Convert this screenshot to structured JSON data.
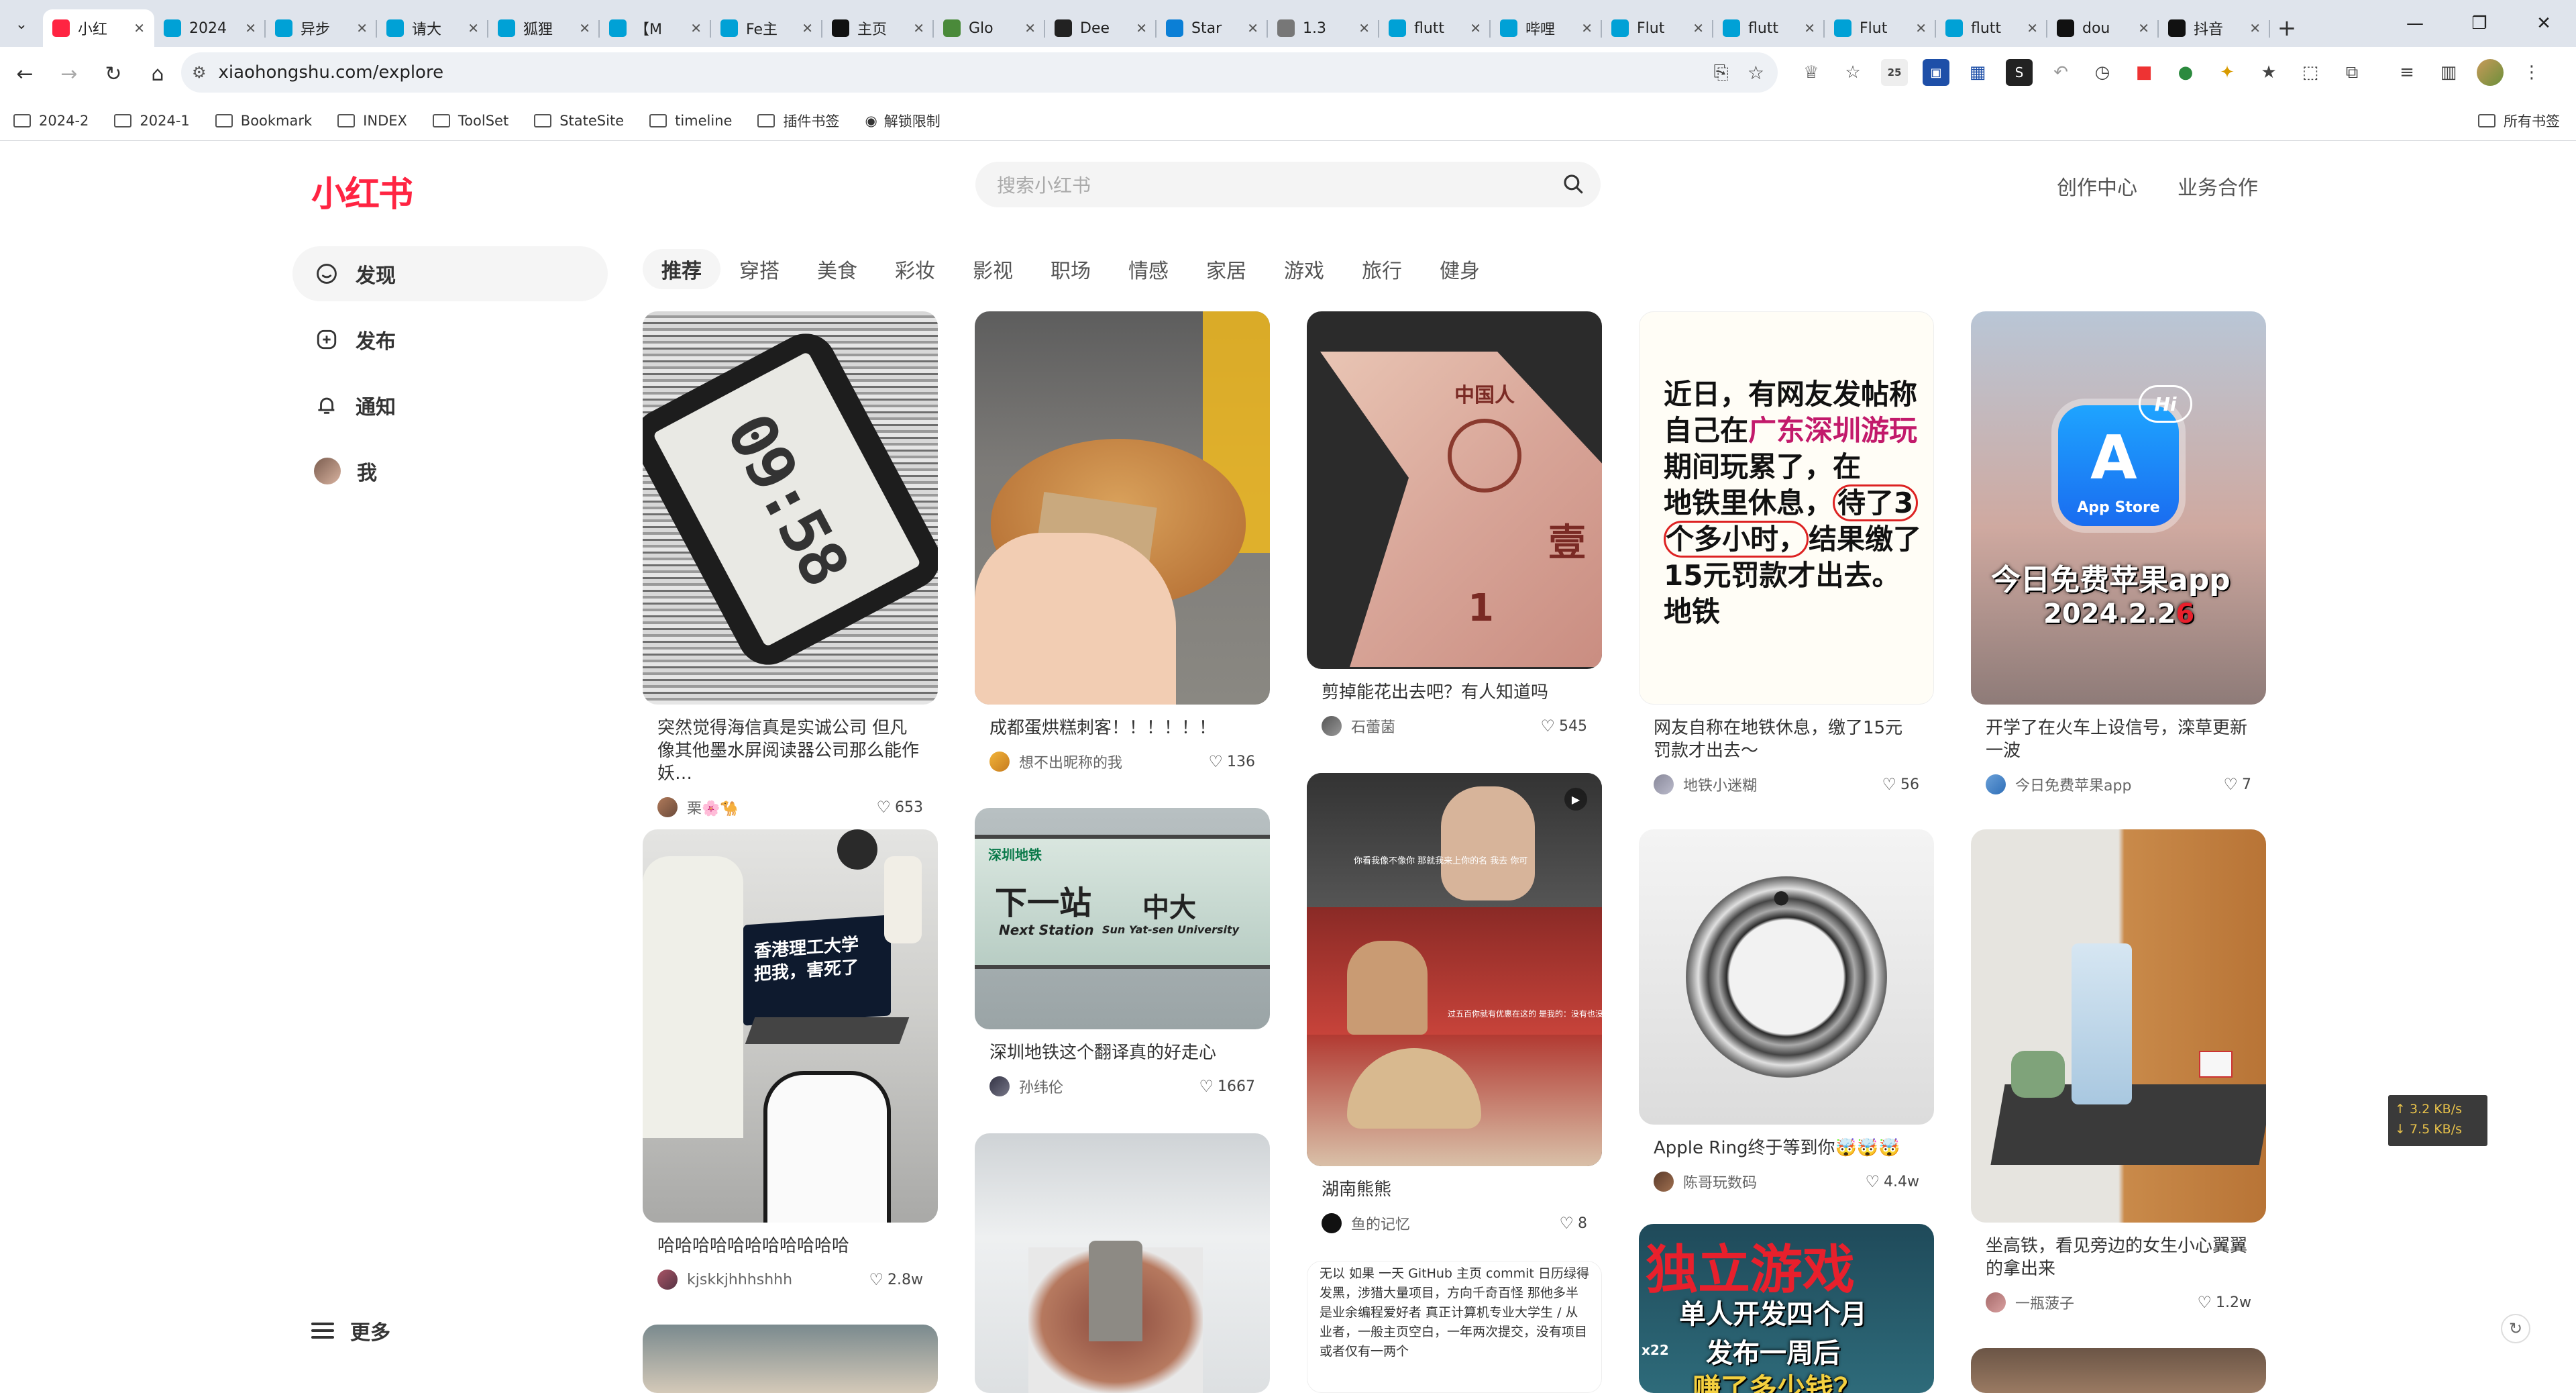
{
  "browser": {
    "tabs": [
      {
        "label": "小红",
        "active": true,
        "color": "#ff2442"
      },
      {
        "label": "2024",
        "color": "#00a1d6"
      },
      {
        "label": "异步",
        "color": "#00a1d6"
      },
      {
        "label": "请大",
        "color": "#00a1d6"
      },
      {
        "label": "狐狸",
        "color": "#00a1d6"
      },
      {
        "label": "【M",
        "color": "#00a1d6"
      },
      {
        "label": "Fe主",
        "color": "#00a1d6"
      },
      {
        "label": "主页",
        "color": "#111111"
      },
      {
        "label": "Glo",
        "color": "#4a8a3a"
      },
      {
        "label": "Dee",
        "color": "#222222"
      },
      {
        "label": "Star",
        "color": "#0b7fd6"
      },
      {
        "label": "1.3",
        "color": "#777777"
      },
      {
        "label": "flutt",
        "color": "#00a1d6"
      },
      {
        "label": "哔哩",
        "color": "#00a1d6"
      },
      {
        "label": "Flut",
        "color": "#00a1d6"
      },
      {
        "label": "flutt",
        "color": "#00a1d6"
      },
      {
        "label": "Flut",
        "color": "#00a1d6"
      },
      {
        "label": "flutt",
        "color": "#00a1d6"
      },
      {
        "label": "dou",
        "color": "#111111"
      },
      {
        "label": "抖音",
        "color": "#111111"
      }
    ],
    "url": "xiaohongshu.com/explore",
    "ext_badge": "25",
    "bookmarks": [
      "2024-2",
      "2024-1",
      "Bookmark",
      "INDEX",
      "ToolSet",
      "StateSite",
      "timeline",
      "插件书签",
      "解锁限制"
    ],
    "all_bookmarks": "所有书签"
  },
  "site": {
    "logo": "小红书",
    "search_placeholder": "搜索小红书",
    "top_links": [
      "创作中心",
      "业务合作"
    ],
    "sidebar": [
      {
        "label": "发现",
        "icon": "home-icon",
        "active": true
      },
      {
        "label": "发布",
        "icon": "plus-icon"
      },
      {
        "label": "通知",
        "icon": "bell-icon"
      },
      {
        "label": "我",
        "icon": "avatar"
      }
    ],
    "more": "更多",
    "channels": [
      "推荐",
      "穿搭",
      "美食",
      "彩妆",
      "影视",
      "职场",
      "情感",
      "家居",
      "游戏",
      "旅行",
      "健身"
    ]
  },
  "feed": {
    "col1": [
      {
        "title": "突然觉得海信真是实诚公司 但凡像其他墨水屏阅读器公司那么能作妖…",
        "author": "栗🌸🐪",
        "likes": "653",
        "clock": "09:58"
      },
      {
        "title": "哈哈哈哈哈哈哈哈哈哈哈",
        "author": "kjskkjhhhshhh",
        "likes": "2.8w",
        "laptop": "香港理工大学 把我，害死了"
      }
    ],
    "col2": [
      {
        "title": "成都蛋烘糕刺客！！！！！！",
        "author": "想不出昵称的我",
        "likes": "136"
      },
      {
        "title": "深圳地铁这个翻译真的好走心",
        "author": "孙纬伦",
        "likes": "1667",
        "sign_a": "下一站",
        "sign_b": "中大",
        "sign_c": "Next Station",
        "sign_d": "Sun Yat-sen University",
        "sign_e": "深圳地铁"
      }
    ],
    "col3": [
      {
        "title": "剪掉能花出去吧？有人知道吗",
        "author": "石蕾菌",
        "likes": "545",
        "money": "中国人",
        "money_b": "壹",
        "money_c": "1"
      },
      {
        "title": "湖南熊熊",
        "author": "鱼的记忆",
        "likes": "8",
        "cap_a": "你看我像不像你 那就我来上你的名 我去 你可",
        "cap_b": "过五百你就有优惠在这的 是我的：没有也没有关系"
      },
      {
        "title": "",
        "author": "",
        "likes": "",
        "text": "无以 如果 一天 GitHub 主页 commit 日历绿得发黑，涉猎大量项目，方向千奇百怪 那他多半是业余编程爱好者 真正计算机专业大学生 / 从业者，一般主页空白，一年两次提交，没有项目或者仅有一两个"
      }
    ],
    "col4": [
      {
        "title": "网友自称在地铁休息，缴了15元罚款才出去～",
        "author": "地铁小迷糊",
        "likes": "56",
        "art_a": "近日，有网友发帖称",
        "art_b": "自己在",
        "art_c": "广东深圳游玩",
        "art_d": "期间玩累了，在",
        "art_e": "地铁里休息，",
        "art_f": "待了3",
        "art_g": "个多小时，",
        "art_h": "结果缴了",
        "art_i": "15元罚款才出去。",
        "art_j": "地铁"
      },
      {
        "title": "Apple Ring终于等到你🤯🤯🤯",
        "author": "陈哥玩数码",
        "likes": "4.4w"
      },
      {
        "title": "",
        "author": "",
        "likes": "",
        "big": "独立游戏",
        "sub1": "单人开发四个月",
        "sub2": "发布一周后",
        "sub3": "赚了多少钱？",
        "tag": "x22"
      }
    ],
    "col5": [
      {
        "title": "开学了在火车上设信号，滦草更新一波",
        "author": "今日免费苹果app",
        "likes": "7",
        "app_store": "App Store",
        "hi": "Hi",
        "big": "今日免费苹果app",
        "date": "2024.2.2",
        "date_red": "6"
      },
      {
        "title": "坐高铁，看见旁边的女生小心翼翼的拿出来",
        "author": "一瓶菠子",
        "likes": "1.2w"
      }
    ]
  },
  "netspeed": {
    "up": "↑ 3.2 KB/s",
    "down": "↓ 7.5 KB/s"
  },
  "colors": {
    "brand": "#ff2442",
    "chrome_bg": "#dfe4ec"
  }
}
